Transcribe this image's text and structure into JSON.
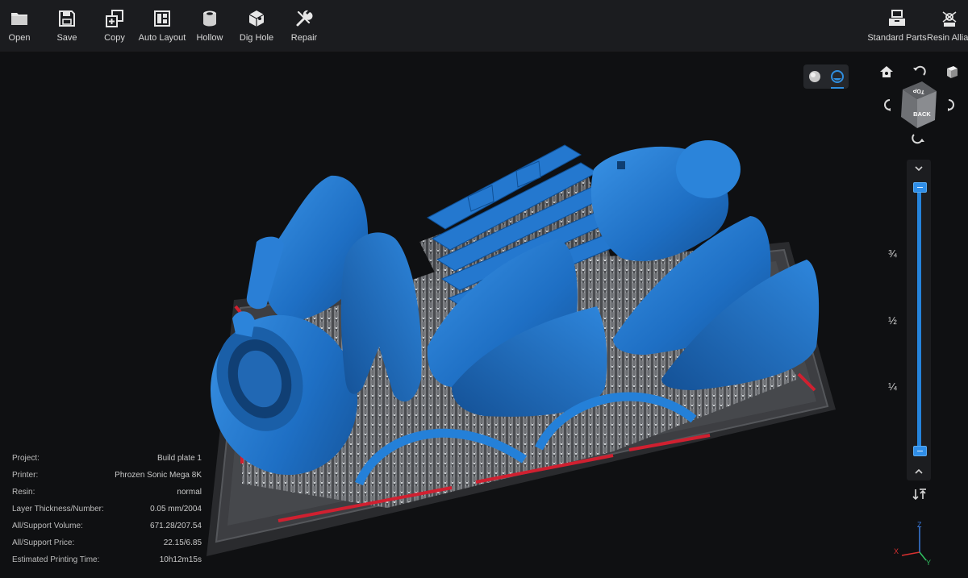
{
  "toolbar": {
    "tools": {
      "open": "Open",
      "save": "Save",
      "copy": "Copy",
      "auto_layout": "Auto Layout",
      "hollow": "Hollow",
      "dig_hole": "Dig Hole",
      "repair": "Repair",
      "standard_parts": "Standard Parts",
      "resin_alliance": "Resin Allianc"
    }
  },
  "nav_cube": {
    "top": "TOP",
    "back": "BACK"
  },
  "slider": {
    "marks": {
      "three_quarter": "¾",
      "half": "½",
      "quarter": "¼"
    },
    "upper_level": 1.0,
    "lower_level": 0.0
  },
  "info": {
    "project": {
      "label": "Project:",
      "value": "Build plate 1"
    },
    "printer": {
      "label": "Printer:",
      "value": "Phrozen Sonic Mega 8K"
    },
    "resin": {
      "label": "Resin:",
      "value": "normal"
    },
    "layer": {
      "label": "Layer Thickness/Number:",
      "value": "0.05 mm/2004"
    },
    "volume": {
      "label": "All/Support Volume:",
      "value": "671.28/207.54"
    },
    "price": {
      "label": "All/Support Price:",
      "value": "22.15/6.85"
    },
    "time": {
      "label": "Estimated Printing Time:",
      "value": "10h12m15s"
    }
  },
  "axes": {
    "z": "Z",
    "x": "X",
    "y": "Y"
  },
  "colors": {
    "model": "#1f74c8",
    "accent": "#2f8ee0",
    "toolbar_bg": "#1b1c1f",
    "viewport_bg": "#0f1012",
    "plate": "#3a3b3e",
    "support": "#b9bcc0",
    "raft_red": "#d02030"
  }
}
